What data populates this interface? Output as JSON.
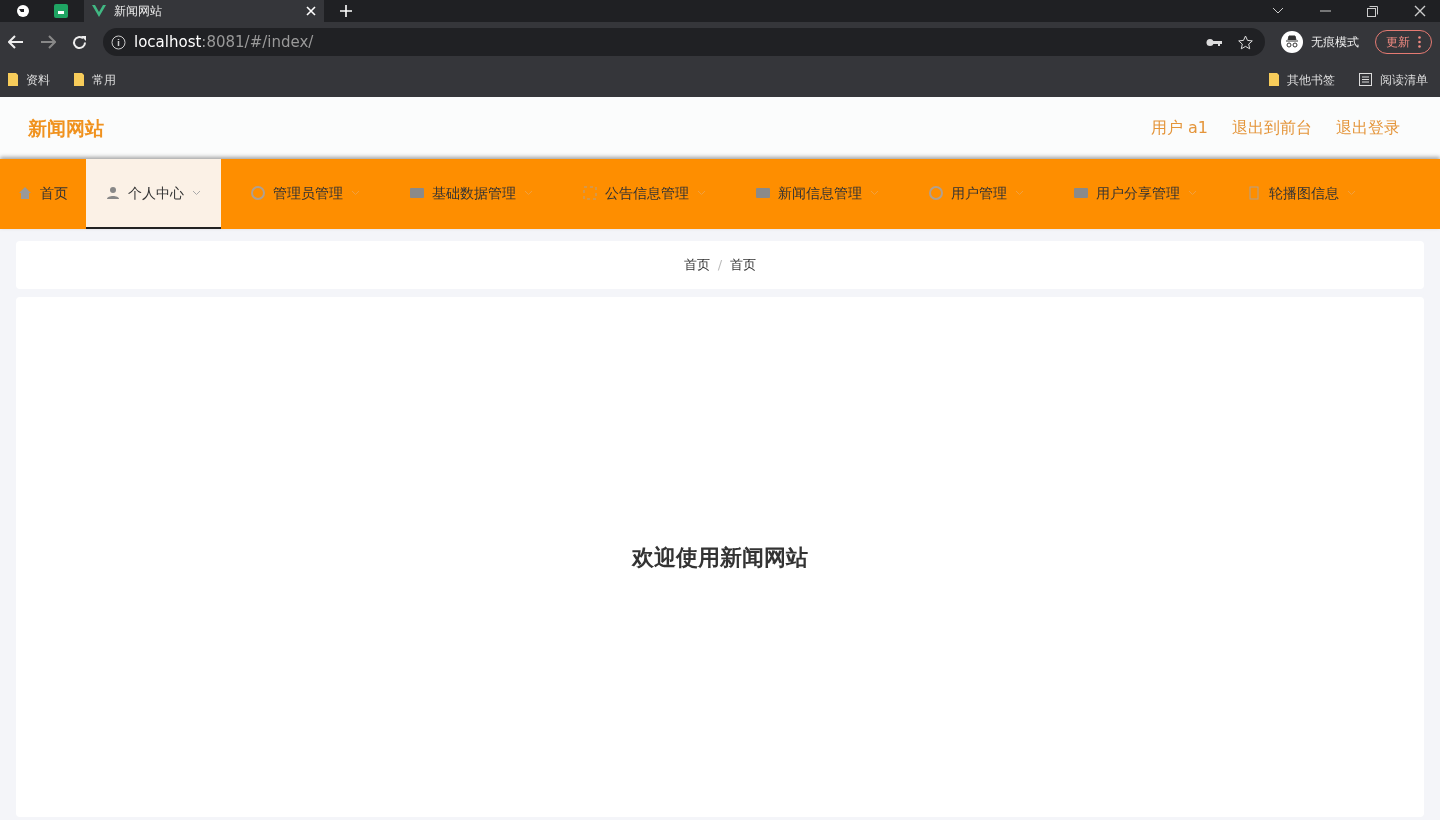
{
  "browser": {
    "tab_title": "新闻网站",
    "address_host": "localhost",
    "address_rest": ":8081/#/index/",
    "incognito_label": "无痕模式",
    "update_button": "更新",
    "bookmarks": [
      "资料",
      "常用"
    ],
    "other_bookmarks": "其他书签",
    "reading_list": "阅读清单"
  },
  "header": {
    "site_title": "新闻网站",
    "links": [
      "用户 a1",
      "退出到前台",
      "退出登录"
    ]
  },
  "nav": [
    {
      "label": "首页",
      "kind": "home",
      "selected": false
    },
    {
      "label": "个人中心",
      "kind": "person",
      "selected": true
    },
    {
      "label": "管理员管理",
      "kind": "circle",
      "selected": false
    },
    {
      "label": "基础数据管理",
      "kind": "square",
      "selected": false
    },
    {
      "label": "公告信息管理",
      "kind": "dashed",
      "selected": false
    },
    {
      "label": "新闻信息管理",
      "kind": "square",
      "selected": false
    },
    {
      "label": "用户管理",
      "kind": "circle",
      "selected": false
    },
    {
      "label": "用户分享管理",
      "kind": "square",
      "selected": false
    },
    {
      "label": "轮播图信息",
      "kind": "doc",
      "selected": false
    }
  ],
  "breadcrumb": {
    "items": [
      "首页",
      "首页"
    ],
    "separator": "/"
  },
  "welcome": "欢迎使用新闻网站"
}
